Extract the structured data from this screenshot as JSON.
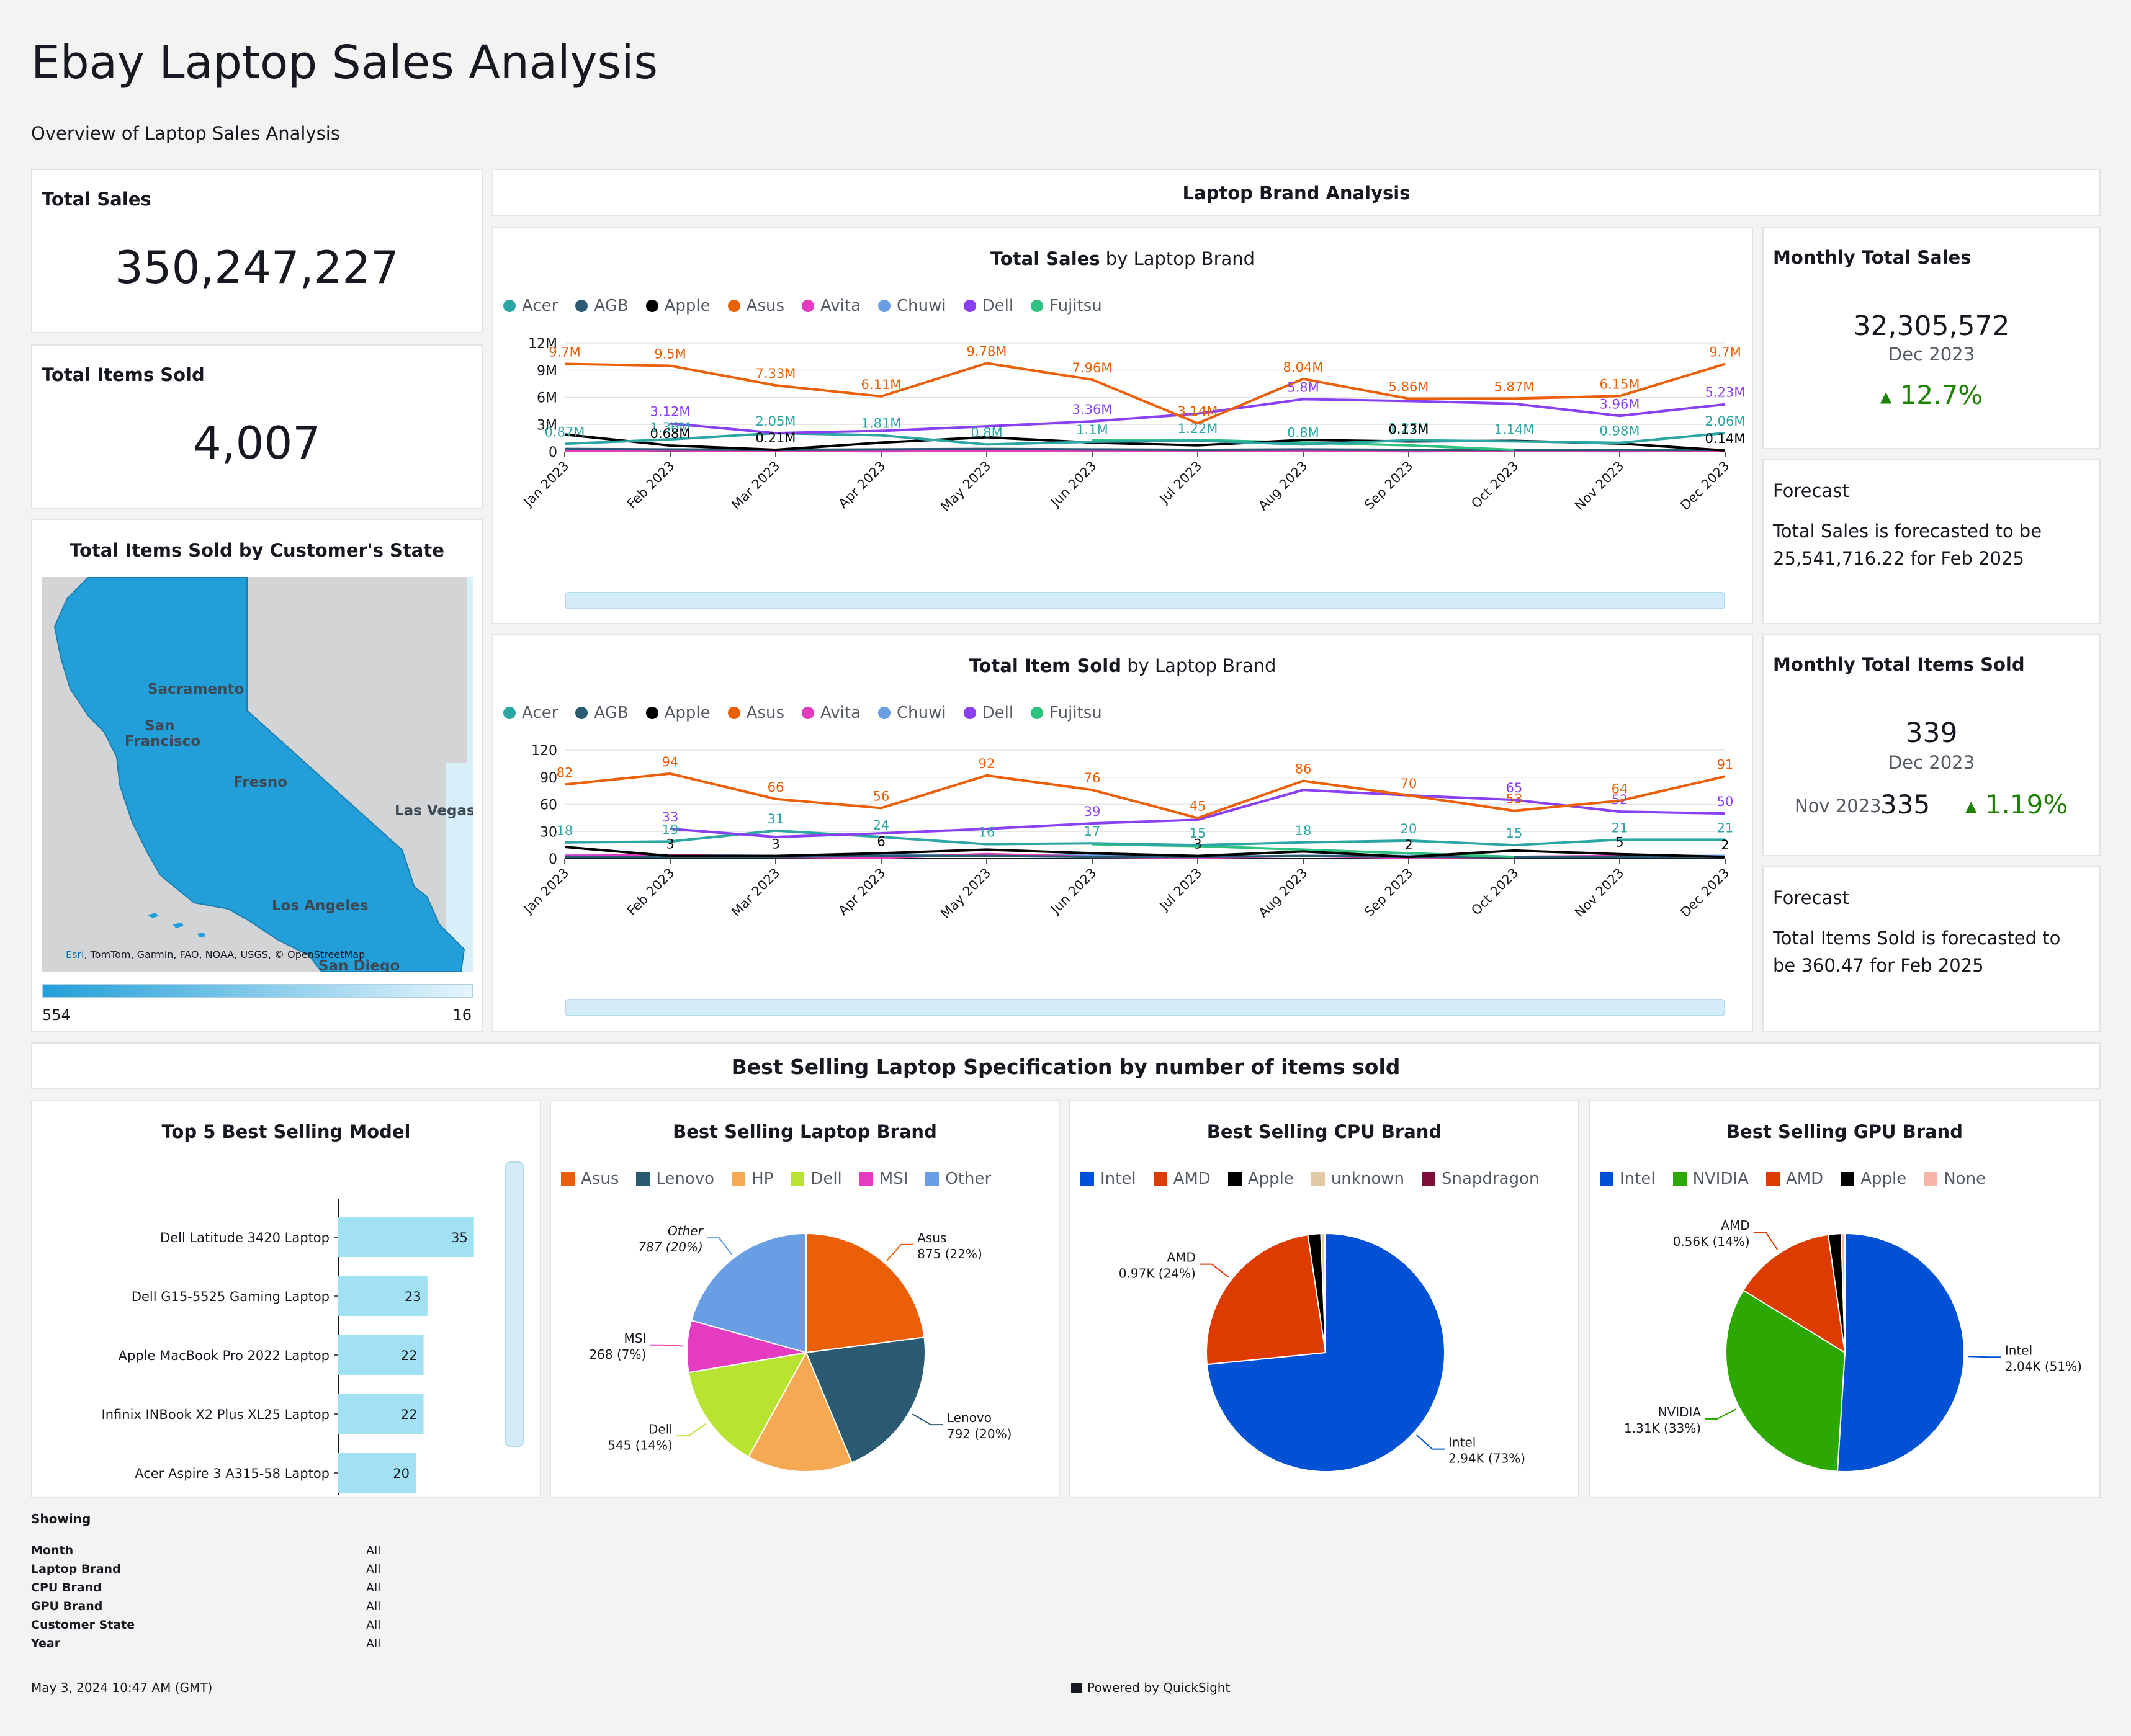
{
  "page": {
    "title": "Ebay Laptop Sales Analysis",
    "subtitle": "Overview of Laptop Sales Analysis"
  },
  "kpis": {
    "total_sales": {
      "label": "Total Sales",
      "value": "350,247,227"
    },
    "total_items": {
      "label": "Total Items Sold",
      "value": "4,007"
    }
  },
  "map": {
    "title": "Total Items Sold by Customer's State",
    "cities": [
      "Sacramento",
      "San",
      "Francisco",
      "Fresno",
      "Las Vegas",
      "Los Angeles",
      "San Diego"
    ],
    "attribution_link": "Esri",
    "attribution": ", TomTom, Garmin, FAO, NOAA, USGS, © OpenStreetMap",
    "legend_max": "554",
    "legend_min": "16",
    "colors": {
      "fill": "#229fd8",
      "land": "#d3d4d5",
      "water": "#d8eef9"
    }
  },
  "section_brand": "Laptop Brand Analysis",
  "legend_brands": [
    {
      "name": "Acer",
      "color": "#2ca6a4"
    },
    {
      "name": "AGB",
      "color": "#2b5b73"
    },
    {
      "name": "Apple",
      "color": "#000000"
    },
    {
      "name": "Asus",
      "color": "#eb5f07"
    },
    {
      "name": "Avita",
      "color": "#e53bc1"
    },
    {
      "name": "Chuwi",
      "color": "#6a9ee4"
    },
    {
      "name": "Dell",
      "color": "#8a3ff0"
    },
    {
      "name": "Fujitsu",
      "color": "#2ec27e"
    }
  ],
  "monthly_sales": {
    "title": "Monthly Total Sales",
    "value": "32,305,572",
    "period": "Dec 2023",
    "change": "12.7%"
  },
  "forecast_sales": {
    "title": "Forecast",
    "text": "Total Sales is forecasted to be 25,541,716.22 for Feb 2025"
  },
  "monthly_items": {
    "title": "Monthly Total Items Sold",
    "value": "339",
    "period": "Dec 2023",
    "prev_label": "Nov 2023",
    "prev_value": "335",
    "change": "1.19%"
  },
  "forecast_items": {
    "title": "Forecast",
    "text": "Total Items Sold is forecasted to be 360.47 for Feb 2025"
  },
  "section_spec": "Best Selling Laptop Specification by number of items sold",
  "showing": {
    "title": "Showing",
    "rows": [
      {
        "k": "Month",
        "v": "All"
      },
      {
        "k": "Laptop Brand",
        "v": "All"
      },
      {
        "k": "CPU Brand",
        "v": "All"
      },
      {
        "k": "GPU Brand",
        "v": "All"
      },
      {
        "k": "Customer State",
        "v": "All"
      },
      {
        "k": "Year",
        "v": "All"
      }
    ]
  },
  "footer": {
    "timestamp": "May 3, 2024 10:47 AM (GMT)",
    "powered": "Powered by QuickSight"
  },
  "chart_data": [
    {
      "type": "line",
      "title_bold": "Total Sales",
      "title_rest": " by Laptop Brand",
      "x": [
        "Jan 2023",
        "Feb 2023",
        "Mar 2023",
        "Apr 2023",
        "May 2023",
        "Jun 2023",
        "Jul 2023",
        "Aug 2023",
        "Sep 2023",
        "Oct 2023",
        "Nov 2023",
        "Dec 2023"
      ],
      "yticks": [
        "0",
        "3M",
        "6M",
        "9M",
        "12M"
      ],
      "ylim": [
        0,
        12000000
      ],
      "series": [
        {
          "name": "Asus",
          "color": "#eb5f07",
          "values": [
            9700000,
            9500000,
            7330000,
            6110000,
            9780000,
            7960000,
            3140000,
            8040000,
            5860000,
            5870000,
            6150000,
            9700000
          ],
          "labels": [
            "9.7M",
            "9.5M",
            "7.33M",
            "6.11M",
            "9.78M",
            "7.96M",
            "3.14M",
            "8.04M",
            "5.86M",
            "5.87M",
            "6.15M",
            "9.7M"
          ]
        },
        {
          "name": "Dell",
          "color": "#8a3ff0",
          "values": [
            null,
            3120000,
            2050000,
            2300000,
            2800000,
            3360000,
            4200000,
            5800000,
            5600000,
            5300000,
            3960000,
            5230000
          ],
          "labels": [
            "",
            "3.12M",
            "",
            "",
            "",
            "3.36M",
            "",
            "5.8M",
            "",
            "",
            "3.96M",
            "5.23M"
          ]
        },
        {
          "name": "Acer",
          "color": "#2ca6a4",
          "values": [
            870000,
            1360000,
            2050000,
            1810000,
            800000,
            1100000,
            1220000,
            800000,
            1270000,
            1140000,
            980000,
            2060000
          ],
          "labels": [
            "0.87M",
            "1.36M",
            "2.05M",
            "1.81M",
            "0.8M",
            "1.1M",
            "1.22M",
            "0.8M",
            "1.27M",
            "1.14M",
            "0.98M",
            "2.06M"
          ]
        },
        {
          "name": "Apple",
          "color": "#000000",
          "values": [
            1900000,
            680000,
            210000,
            1000000,
            1600000,
            1000000,
            700000,
            1300000,
            1130000,
            1200000,
            900000,
            140000
          ],
          "labels": [
            "",
            "0.68M",
            "0.21M",
            "",
            "",
            "",
            "",
            "",
            "0.13M",
            "",
            "",
            "0.14M"
          ]
        },
        {
          "name": "Fujitsu",
          "color": "#2ec27e",
          "values": [
            null,
            null,
            null,
            null,
            null,
            1300000,
            1300000,
            1000000,
            700000,
            200000,
            null,
            null
          ],
          "labels": []
        },
        {
          "name": "AGB",
          "color": "#2b5b73",
          "values": [
            300000,
            250000,
            200000,
            250000,
            300000,
            250000,
            200000,
            250000,
            200000,
            200000,
            200000,
            200000
          ],
          "labels": []
        },
        {
          "name": "Avita",
          "color": "#e53bc1",
          "values": [
            100000,
            150000,
            100000,
            50000,
            100000,
            100000,
            100000,
            100000,
            50000,
            100000,
            50000,
            100000
          ],
          "labels": []
        },
        {
          "name": "Chuwi",
          "color": "#6a9ee4",
          "values": [
            200000,
            200000,
            150000,
            200000,
            150000,
            200000,
            100000,
            150000,
            150000,
            100000,
            150000,
            150000
          ],
          "labels": []
        }
      ]
    },
    {
      "type": "line",
      "title_bold": "Total Item Sold",
      "title_rest": " by Laptop Brand",
      "x": [
        "Jan 2023",
        "Feb 2023",
        "Mar 2023",
        "Apr 2023",
        "May 2023",
        "Jun 2023",
        "Jul 2023",
        "Aug 2023",
        "Sep 2023",
        "Oct 2023",
        "Nov 2023",
        "Dec 2023"
      ],
      "yticks": [
        "0",
        "30",
        "60",
        "90",
        "120"
      ],
      "ylim": [
        0,
        120
      ],
      "series": [
        {
          "name": "Asus",
          "color": "#eb5f07",
          "values": [
            82,
            94,
            66,
            56,
            92,
            76,
            45,
            86,
            70,
            53,
            64,
            91
          ],
          "labels": [
            "82",
            "94",
            "66",
            "56",
            "92",
            "76",
            "45",
            "86",
            "70",
            "53",
            "64",
            "91"
          ]
        },
        {
          "name": "Dell",
          "color": "#8a3ff0",
          "values": [
            null,
            33,
            24,
            28,
            33,
            39,
            43,
            76,
            70,
            65,
            52,
            50
          ],
          "labels": [
            "",
            "33",
            "",
            "",
            "",
            "39",
            "",
            "",
            "",
            "65",
            "52",
            "50"
          ]
        },
        {
          "name": "Acer",
          "color": "#2ca6a4",
          "values": [
            18,
            19,
            31,
            24,
            16,
            17,
            15,
            18,
            20,
            15,
            21,
            21
          ],
          "labels": [
            "18",
            "19",
            "31",
            "24",
            "16",
            "17",
            "15",
            "18",
            "20",
            "15",
            "21",
            "21"
          ]
        },
        {
          "name": "Apple",
          "color": "#000000",
          "values": [
            13,
            3,
            3,
            6,
            10,
            6,
            3,
            8,
            2,
            9,
            5,
            2
          ],
          "labels": [
            "",
            "3",
            "3",
            "6",
            "",
            "",
            "3",
            "",
            "2",
            "",
            "5",
            "2"
          ]
        },
        {
          "name": "Fujitsu",
          "color": "#2ec27e",
          "values": [
            null,
            null,
            null,
            null,
            null,
            16,
            14,
            10,
            6,
            2,
            null,
            null
          ],
          "labels": []
        },
        {
          "name": "AGB",
          "color": "#2b5b73",
          "values": [
            2,
            2,
            2,
            3,
            3,
            2,
            2,
            3,
            2,
            2,
            2,
            2
          ],
          "labels": []
        },
        {
          "name": "Avita",
          "color": "#e53bc1",
          "values": [
            3,
            4,
            2,
            1,
            5,
            2,
            1,
            3,
            1,
            2,
            3,
            2
          ],
          "labels": []
        },
        {
          "name": "Chuwi",
          "color": "#6a9ee4",
          "values": [
            4,
            4,
            3,
            4,
            3,
            4,
            2,
            3,
            3,
            2,
            3,
            3
          ],
          "labels": []
        }
      ]
    },
    {
      "type": "bar",
      "title": "Top 5 Best Selling Model",
      "categories": [
        "Dell Latitude 3420 Laptop",
        "Dell G15-5525 Gaming Laptop",
        "Apple MacBook Pro 2022 Laptop",
        "Infinix INBook X2 Plus XL25 Laptop",
        "Acer Aspire 3 A315-58 Laptop"
      ],
      "values": [
        35,
        23,
        22,
        22,
        20
      ],
      "xticks": [
        "0",
        "10",
        "20",
        "30",
        "40"
      ],
      "xlim": [
        0,
        40
      ],
      "color": "#a2e0f3"
    },
    {
      "type": "pie",
      "title": "Best Selling Laptop Brand",
      "slices": [
        {
          "name": "Asus",
          "value": 875,
          "label": "875 (22%)",
          "color": "#eb5f07"
        },
        {
          "name": "Lenovo",
          "value": 792,
          "label": "792 (20%)",
          "color": "#2b5b73"
        },
        {
          "name": "HP",
          "value": 545,
          "label": "",
          "color": "#f5a952"
        },
        {
          "name": "Dell",
          "value": 545,
          "label": "545 (14%)",
          "color": "#b8e330"
        },
        {
          "name": "MSI",
          "value": 268,
          "label": "268 (7%)",
          "color": "#e53bc1"
        },
        {
          "name": "Other",
          "value": 787,
          "label": "787 (20%)",
          "color": "#6a9ee4"
        }
      ]
    },
    {
      "type": "pie",
      "title": "Best Selling CPU Brand",
      "slices": [
        {
          "name": "Intel",
          "value": 2940,
          "label": "2.94K (73%)",
          "color": "#0051d4"
        },
        {
          "name": "AMD",
          "value": 970,
          "label": "0.97K (24%)",
          "color": "#de3b00"
        },
        {
          "name": "Apple",
          "value": 70,
          "label": "",
          "color": "#000000"
        },
        {
          "name": "unknown",
          "value": 20,
          "label": "",
          "color": "#e0cba6"
        },
        {
          "name": "Snapdragon",
          "value": 5,
          "label": "",
          "color": "#7f0d3a"
        }
      ]
    },
    {
      "type": "pie",
      "title": "Best Selling GPU Brand",
      "slices": [
        {
          "name": "Intel",
          "value": 2040,
          "label": "2.04K (51%)",
          "color": "#0051d4"
        },
        {
          "name": "NVIDIA",
          "value": 1310,
          "label": "1.31K (33%)",
          "color": "#2ca800"
        },
        {
          "name": "AMD",
          "value": 560,
          "label": "0.56K (14%)",
          "color": "#de3b00"
        },
        {
          "name": "Apple",
          "value": 70,
          "label": "",
          "color": "#000000"
        },
        {
          "name": "None",
          "value": 20,
          "label": "",
          "color": "#f7b5a8"
        }
      ]
    }
  ]
}
